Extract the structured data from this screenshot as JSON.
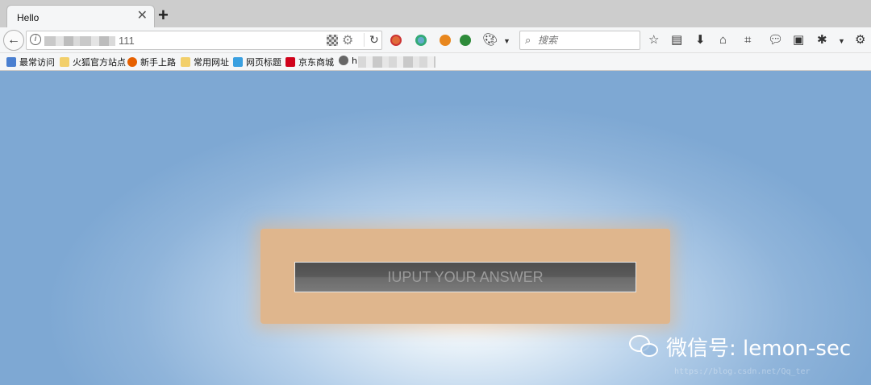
{
  "tab": {
    "title": "Hello",
    "close_symbol": "✕",
    "new_tab_symbol": "+"
  },
  "navbar": {
    "back_symbol": "←",
    "url_suffix": "111",
    "search_placeholder": "搜索",
    "reload_symbol": "↻"
  },
  "bookmarks": [
    {
      "label": "最常访问",
      "icon_color": "#4a7fd0"
    },
    {
      "label": "火狐官方站点",
      "icon_color": "#f2cf6a"
    },
    {
      "label": "新手上路",
      "icon_color": "#e66000"
    },
    {
      "label": "常用网址",
      "icon_color": "#f2cf6a"
    },
    {
      "label": "网页标题",
      "icon_color": "#3aa0e0"
    },
    {
      "label": "京东商城",
      "icon_color": "#d0021b"
    },
    {
      "label": "h",
      "icon_color": "#666666"
    }
  ],
  "page": {
    "answer_placeholder": "IUPUT YOUR ANSWER",
    "watermark": "微信号: lemon-sec",
    "watermark_url": "https://blog.csdn.net/Qq_ter"
  },
  "colors": {
    "panel": "#dfb68d",
    "input_bg": "#5a5a5a",
    "page_bg": "#8fb4da"
  }
}
